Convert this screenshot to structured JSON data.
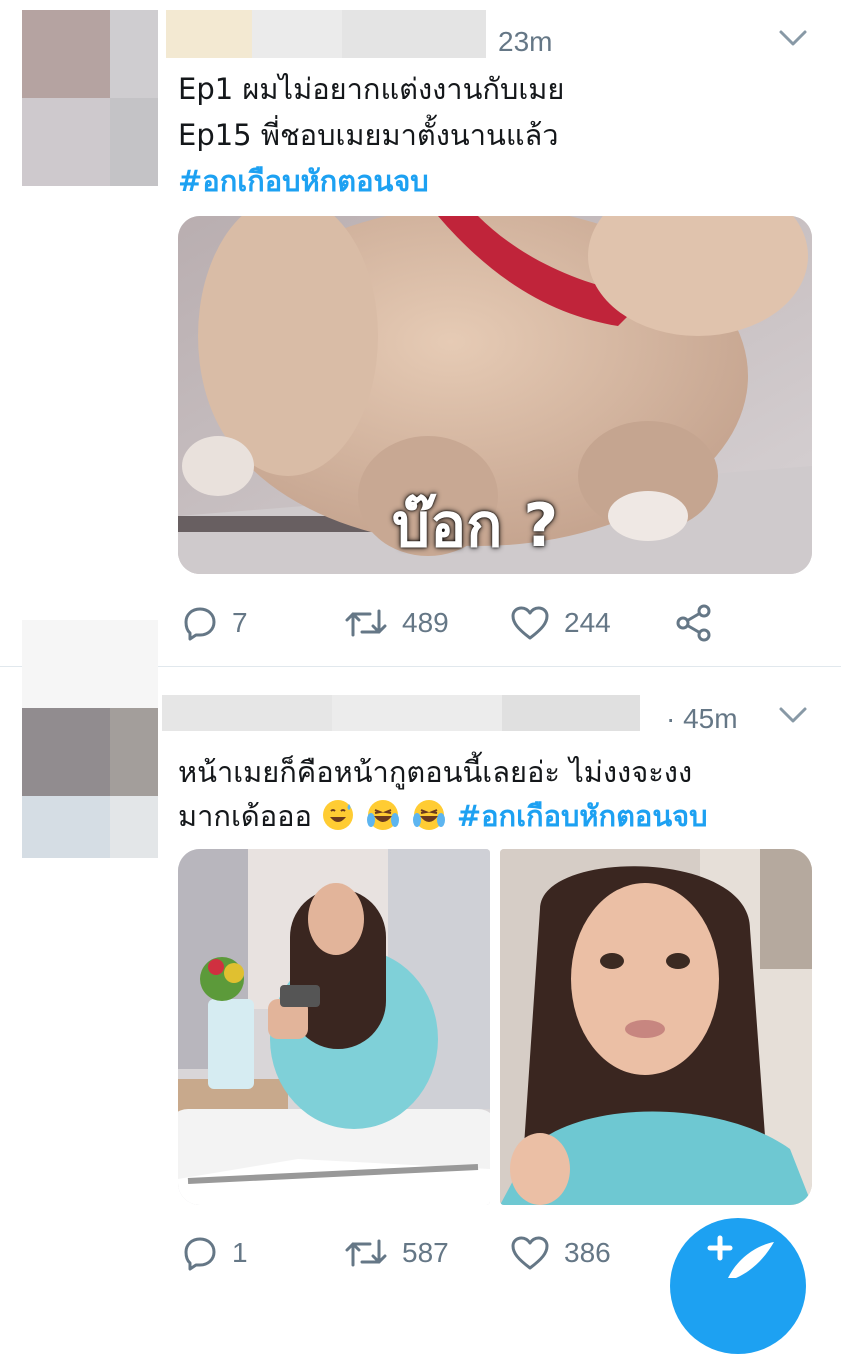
{
  "tweets": [
    {
      "time": "23m",
      "lines": [
        "Ep1 ผมไม่อยากแต่งงานกับเมย",
        "Ep15 พี่ชอบเมยมาตั้งนานแล้ว"
      ],
      "hashtag": "#อกเกือบหักตอนจบ",
      "media_caption": "บ๊อก ?",
      "stats": {
        "replies": "7",
        "retweets": "489",
        "likes": "244"
      }
    },
    {
      "time": "· 45m",
      "line1": "หน้าเมยก็คือหน้ากูตอนนี้เลยอ่ะ ไม่งงจะงง",
      "line2_text": "มากเด้อออ",
      "emojis": [
        "😅",
        "😂",
        "😂"
      ],
      "hashtag": "#อกเกือบหักตอนจบ",
      "stats": {
        "replies": "1",
        "retweets": "587",
        "likes": "386"
      }
    }
  ],
  "icons": {
    "reply": "reply-icon",
    "retweet": "retweet-icon",
    "like": "heart-icon",
    "share": "share-icon",
    "menu": "chevron-down-icon",
    "compose": "compose-icon"
  },
  "colors": {
    "accent": "#1da1f2",
    "muted": "#657786",
    "text": "#14171a",
    "divider": "#e1e8ed"
  }
}
